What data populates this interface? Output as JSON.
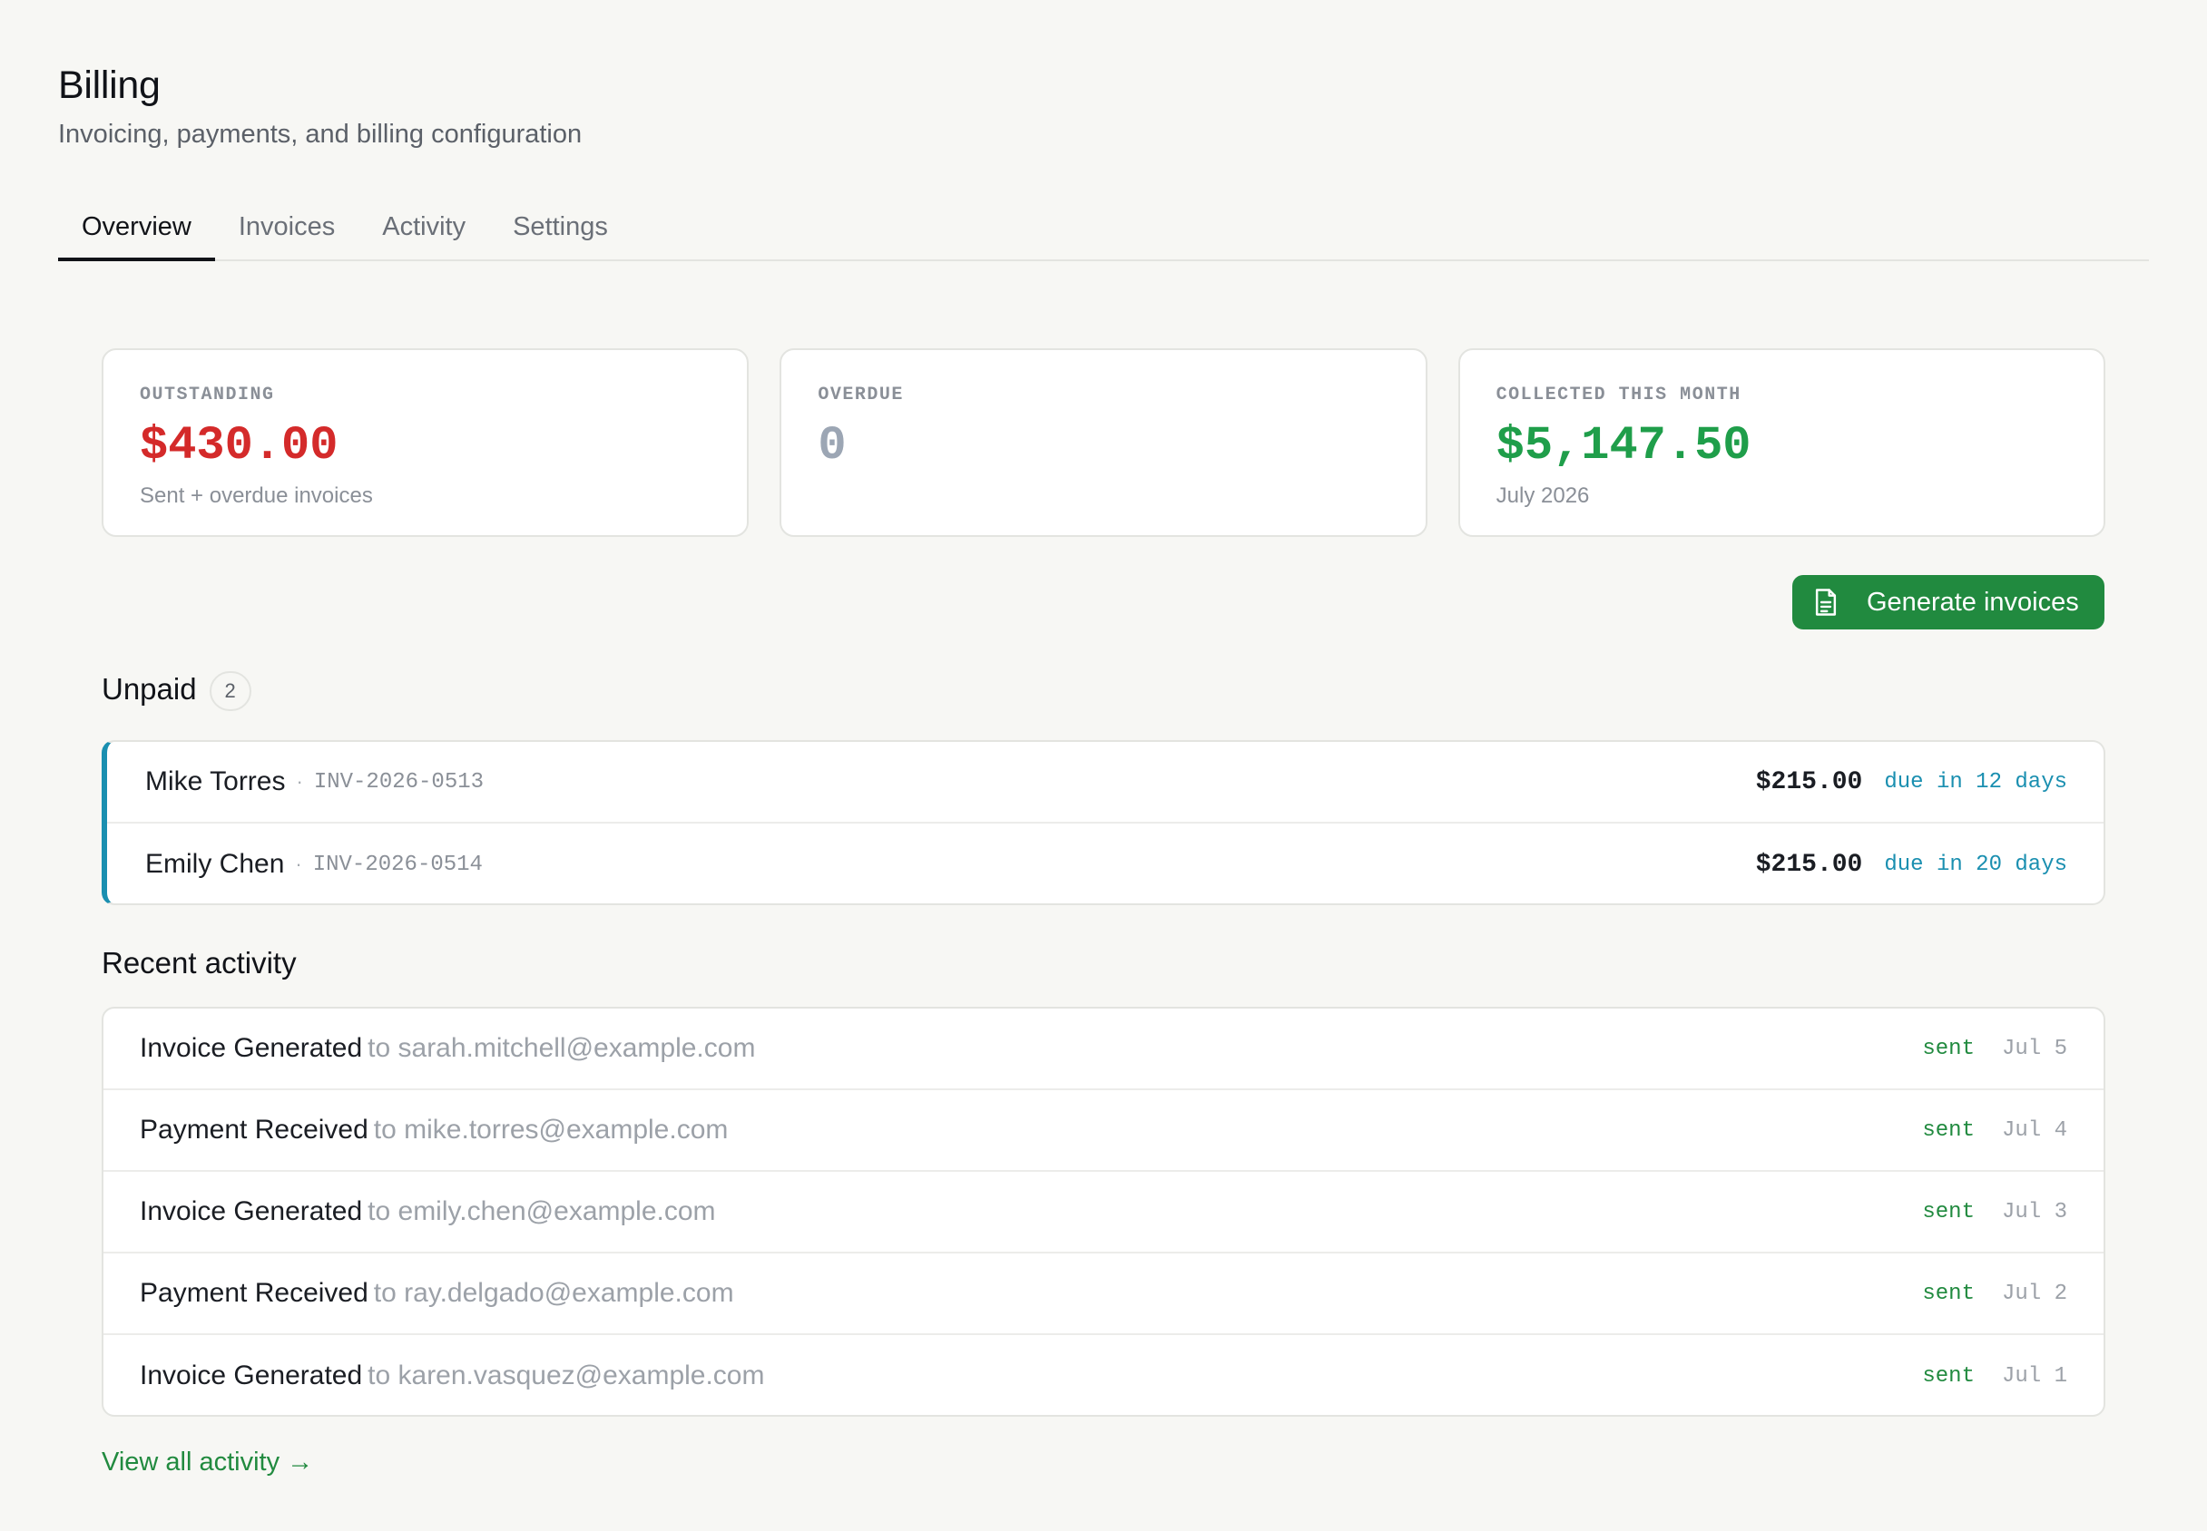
{
  "header": {
    "title": "Billing",
    "subtitle": "Invoicing, payments, and billing configuration"
  },
  "tabs": [
    {
      "label": "Overview",
      "active": true
    },
    {
      "label": "Invoices",
      "active": false
    },
    {
      "label": "Activity",
      "active": false
    },
    {
      "label": "Settings",
      "active": false
    }
  ],
  "stats": {
    "outstanding": {
      "label": "OUTSTANDING",
      "value": "$430.00",
      "note": "Sent + overdue invoices",
      "color": "#d42a2a"
    },
    "overdue": {
      "label": "OVERDUE",
      "value": "0",
      "color": "#9ca6b4"
    },
    "collected": {
      "label": "COLLECTED THIS MONTH",
      "value": "$5,147.50",
      "note": "July 2026",
      "color": "#1f9e4a"
    }
  },
  "actions": {
    "generate_label": "Generate invoices",
    "generate_icon": "document-icon"
  },
  "unpaid": {
    "title": "Unpaid",
    "count": "2",
    "separator": "·",
    "items": [
      {
        "name": "Mike Torres",
        "invoice": "INV-2026-0513",
        "amount": "$215.00",
        "due": "due in 12 days"
      },
      {
        "name": "Emily Chen",
        "invoice": "INV-2026-0514",
        "amount": "$215.00",
        "due": "due in 20 days"
      }
    ]
  },
  "activity": {
    "title": "Recent activity",
    "items": [
      {
        "event": "Invoice Generated",
        "to": "to sarah.mitchell@example.com",
        "status": "sent",
        "date": "Jul 5"
      },
      {
        "event": "Payment Received",
        "to": "to mike.torres@example.com",
        "status": "sent",
        "date": "Jul 4"
      },
      {
        "event": "Invoice Generated",
        "to": "to emily.chen@example.com",
        "status": "sent",
        "date": "Jul 3"
      },
      {
        "event": "Payment Received",
        "to": "to ray.delgado@example.com",
        "status": "sent",
        "date": "Jul 2"
      },
      {
        "event": "Invoice Generated",
        "to": "to karen.vasquez@example.com",
        "status": "sent",
        "date": "Jul 1"
      }
    ],
    "view_all": "View all activity →"
  }
}
